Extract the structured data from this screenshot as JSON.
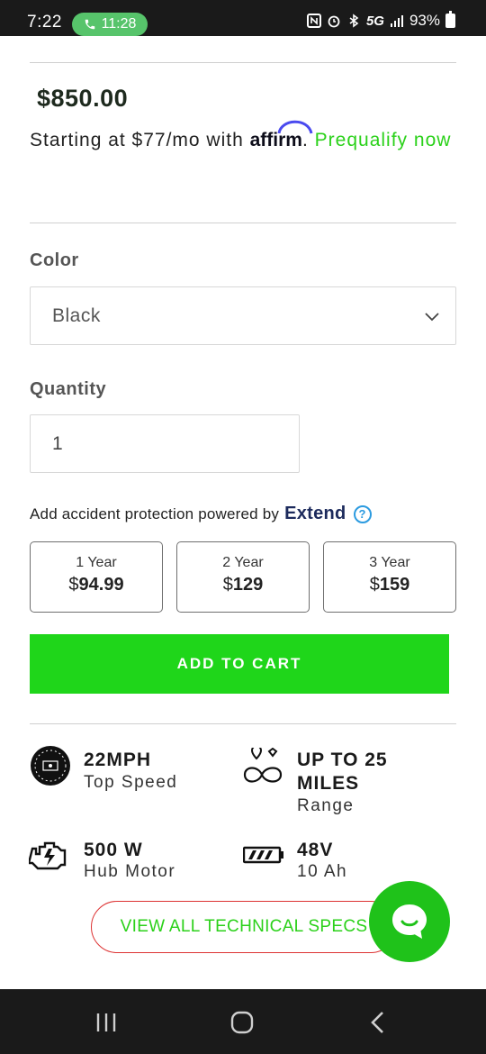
{
  "status_bar": {
    "time": "7:22",
    "call_timer": "11:28",
    "network": "5G",
    "battery": "93%"
  },
  "product": {
    "price": "$850.00",
    "financing": {
      "prefix": "Starting at $77/mo with",
      "brand": "affirm",
      "suffix": ".",
      "link_label": "Prequalify now"
    }
  },
  "color_option": {
    "label": "Color",
    "selected": "Black"
  },
  "quantity_option": {
    "label": "Quantity",
    "value": "1"
  },
  "protection": {
    "intro": "Add accident protection powered by",
    "brand": "Extend",
    "help_glyph": "?",
    "plans": [
      {
        "term": "1 Year",
        "currency": "$",
        "price": "94.99"
      },
      {
        "term": "2 Year",
        "currency": "$",
        "price": "129"
      },
      {
        "term": "3 Year",
        "currency": "$",
        "price": "159"
      }
    ]
  },
  "add_to_cart_label": "ADD TO CART",
  "specs": [
    {
      "icon": "speedometer-icon",
      "title": "22MPH",
      "subtitle": "Top Speed"
    },
    {
      "icon": "route-icon",
      "title": "UP TO 25 MILES",
      "subtitle": "Range"
    },
    {
      "icon": "engine-icon",
      "title": "500 W",
      "subtitle": "Hub Motor"
    },
    {
      "icon": "battery-icon",
      "title": "48V",
      "subtitle": "10 Ah"
    }
  ],
  "view_specs_label": "VIEW ALL TECHNICAL SPECS",
  "colors": {
    "accent_green": "#1fd61a",
    "link_green": "#2bd11a",
    "specs_border": "#dd3333",
    "extend_blue": "#1c2a5c"
  }
}
